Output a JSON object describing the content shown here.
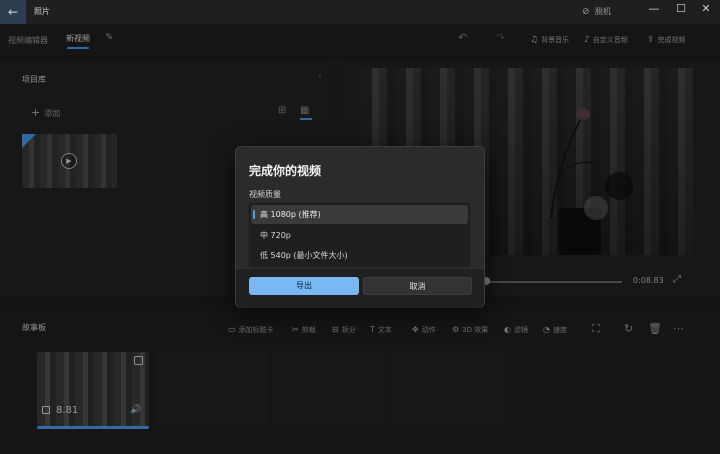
{
  "titlebar": {
    "app_title": "照片",
    "offline_label": "脱机",
    "window_controls": [
      "—",
      "☐",
      "✕"
    ]
  },
  "toolbar": {
    "tabs": [
      "视频编辑器",
      "新视频"
    ],
    "commands": [
      "背景音乐",
      "自定义音频",
      "完成视频"
    ]
  },
  "library": {
    "title": "项目库",
    "add_label": "添加"
  },
  "preview": {
    "time": "0:08.83"
  },
  "storyboard": {
    "title": "故事板",
    "commands": [
      "添加标题卡",
      "剪裁",
      "拆分",
      "文本",
      "动作",
      "3D 效果",
      "滤镜",
      "速度"
    ],
    "clip_duration": "8.81"
  },
  "dialog": {
    "title": "完成你的视频",
    "quality_label": "视频质量",
    "options": [
      {
        "label": "高 1080p (推荐)",
        "selected": true
      },
      {
        "label": "中 720p",
        "selected": false
      },
      {
        "label": "低 540p (最小文件大小)",
        "selected": false
      }
    ],
    "export_label": "导出",
    "cancel_label": "取消"
  },
  "colors": {
    "accent": "#4a9eef",
    "export_button": "#79b8f3"
  }
}
